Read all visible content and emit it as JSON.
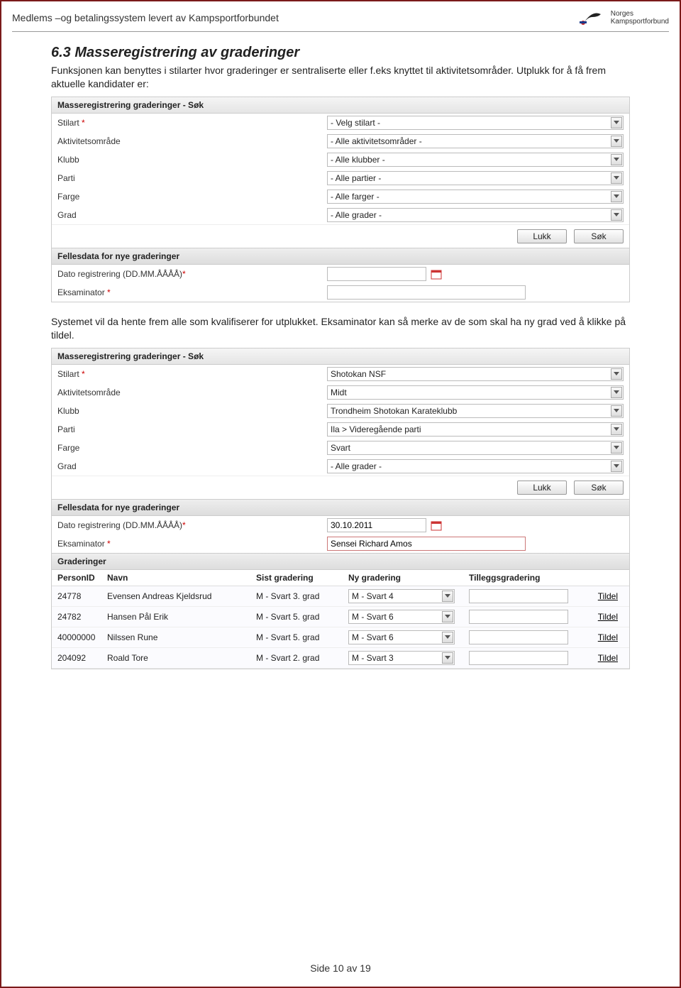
{
  "header": {
    "title": "Medlems –og betalingssystem levert av Kampsportforbundet",
    "logo_line1": "Norges",
    "logo_line2": "Kampsportforbund"
  },
  "section": {
    "number_title": "6.3  Masseregistrering av graderinger",
    "para1": "Funksjonen kan benyttes i stilarter hvor graderinger er sentraliserte eller f.eks knyttet til aktivitetsområder. Utplukk for å få frem aktuelle kandidater er:",
    "para2": "Systemet vil da hente frem alle som kvalifiserer for utplukket. Eksaminator kan så merke av de som skal ha ny grad ved å klikke på tildel."
  },
  "panel1": {
    "title": "Masseregistrering graderinger - Søk",
    "fields": {
      "stilart_label": "Stilart",
      "stilart_value": "- Velg stilart -",
      "aktivitet_label": "Aktivitetsområde",
      "aktivitet_value": "- Alle aktivitetsområder -",
      "klubb_label": "Klubb",
      "klubb_value": "- Alle klubber -",
      "parti_label": "Parti",
      "parti_value": "- Alle partier -",
      "farge_label": "Farge",
      "farge_value": "- Alle farger -",
      "grad_label": "Grad",
      "grad_value": "- Alle grader -"
    },
    "buttons": {
      "lukk": "Lukk",
      "sok": "Søk"
    },
    "sub_title": "Fellesdata for nye graderinger",
    "dato_label": "Dato registrering (DD.MM.ÅÅÅÅ)",
    "dato_value": "",
    "eksaminator_label": "Eksaminator",
    "eksaminator_value": ""
  },
  "panel2": {
    "title": "Masseregistrering graderinger - Søk",
    "fields": {
      "stilart_label": "Stilart",
      "stilart_value": "Shotokan NSF",
      "aktivitet_label": "Aktivitetsområde",
      "aktivitet_value": "Midt",
      "klubb_label": "Klubb",
      "klubb_value": "Trondheim Shotokan Karateklubb",
      "parti_label": "Parti",
      "parti_value": "Ila > Videregående parti",
      "farge_label": "Farge",
      "farge_value": "Svart",
      "grad_label": "Grad",
      "grad_value": "- Alle grader -"
    },
    "buttons": {
      "lukk": "Lukk",
      "sok": "Søk"
    },
    "sub_title": "Fellesdata for nye graderinger",
    "dato_label": "Dato registrering (DD.MM.ÅÅÅÅ)",
    "dato_value": "30.10.2011",
    "eksaminator_label": "Eksaminator",
    "eksaminator_value": "Sensei Richard Amos",
    "grad_section_title": "Graderinger",
    "columns": {
      "personid": "PersonID",
      "navn": "Navn",
      "sist": "Sist gradering",
      "ny": "Ny gradering",
      "till": "Tilleggsgradering",
      "tildel": "Tildel"
    },
    "rows": [
      {
        "pid": "24778",
        "navn": "Evensen Andreas Kjeldsrud",
        "sist": "M - Svart 3. grad",
        "ny": "M - Svart 4"
      },
      {
        "pid": "24782",
        "navn": "Hansen Pål Erik",
        "sist": "M - Svart 5. grad",
        "ny": "M - Svart 6"
      },
      {
        "pid": "40000000",
        "navn": "Nilssen Rune",
        "sist": "M - Svart 5. grad",
        "ny": "M - Svart 6"
      },
      {
        "pid": "204092",
        "navn": "Roald Tore",
        "sist": "M - Svart 2. grad",
        "ny": "M - Svart 3"
      }
    ]
  },
  "footer": "Side 10 av 19",
  "req_marker": "*"
}
